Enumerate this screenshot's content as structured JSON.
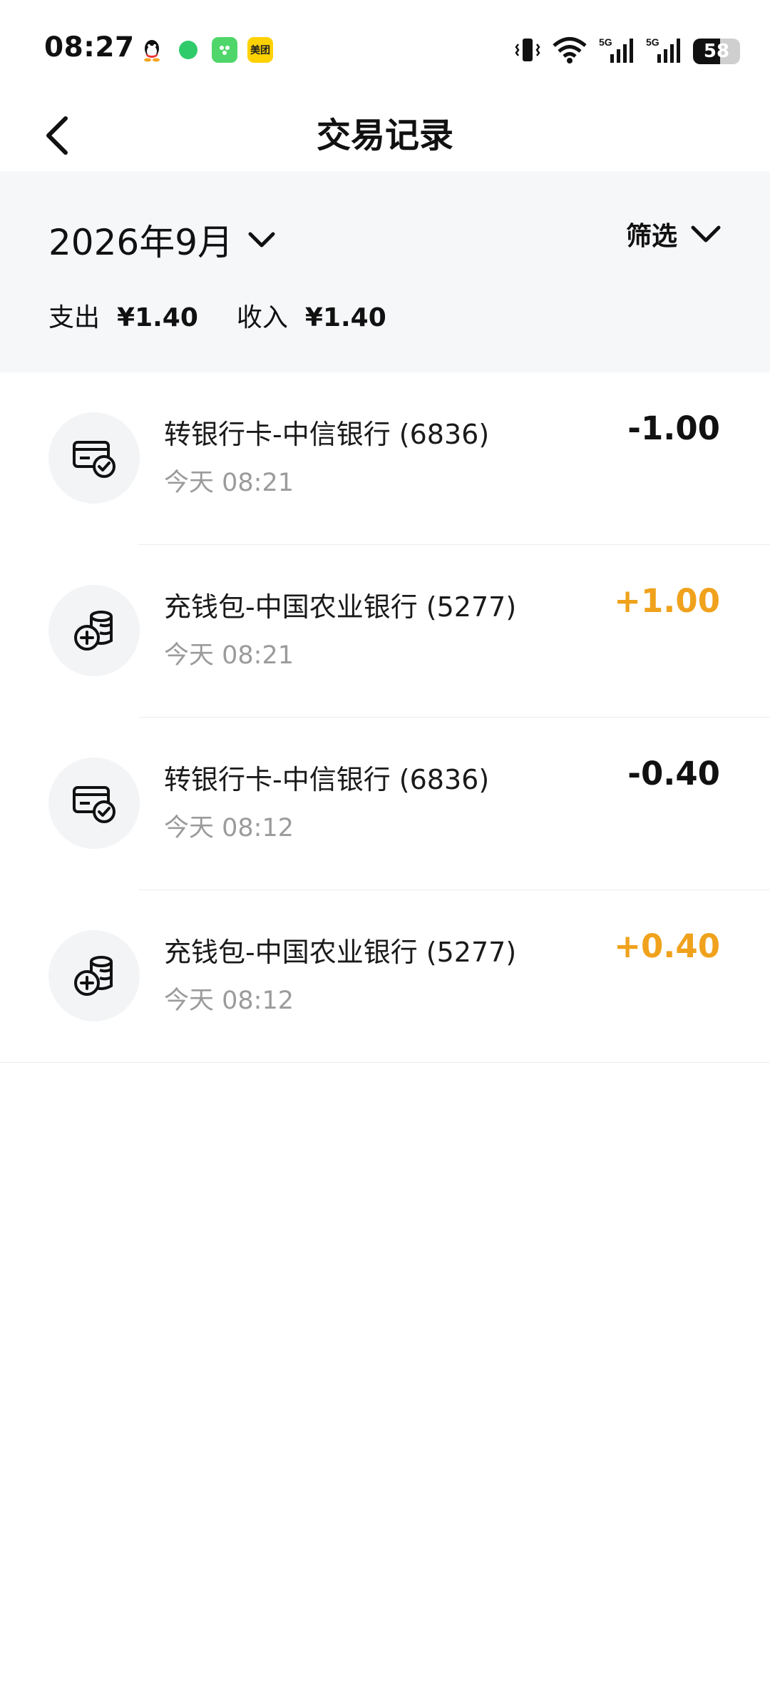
{
  "status_bar": {
    "time": "08:27",
    "apps": [
      "qq-icon",
      "message-icon",
      "green-app-icon",
      "meituan-icon"
    ],
    "meituan_label": "美团",
    "signal_labels": [
      "5G",
      "5G"
    ],
    "battery": "58"
  },
  "nav": {
    "title": "交易记录"
  },
  "summary": {
    "month": "2026年9月",
    "filter_label": "筛选",
    "expense_label": "支出",
    "expense_value": "¥1.40",
    "income_label": "收入",
    "income_value": "¥1.40"
  },
  "transactions": [
    {
      "title": "转银行卡-中信银行 (6836)",
      "time": "今天 08:21",
      "amount": "-1.00",
      "type": "out",
      "icon": "card-check-icon"
    },
    {
      "title": "充钱包-中国农业银行 (5277)",
      "time": "今天 08:21",
      "amount": "+1.00",
      "type": "in",
      "icon": "coins-add-icon"
    },
    {
      "title": "转银行卡-中信银行 (6836)",
      "time": "今天 08:12",
      "amount": "-0.40",
      "type": "out",
      "icon": "card-check-icon"
    },
    {
      "title": "充钱包-中国农业银行 (5277)",
      "time": "今天 08:12",
      "amount": "+0.40",
      "type": "in",
      "icon": "coins-add-icon"
    }
  ],
  "colors": {
    "income": "#f0a21c",
    "expense": "#111111",
    "panel_bg": "#f6f7f9"
  }
}
